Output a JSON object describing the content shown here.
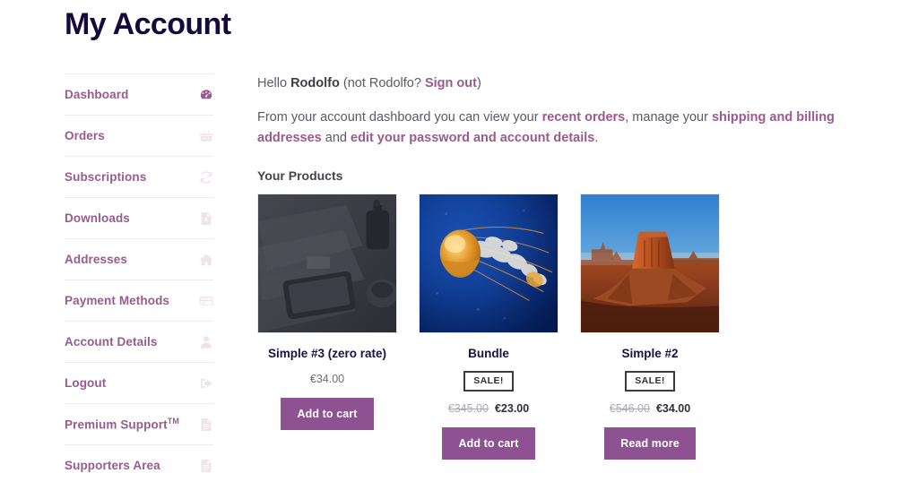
{
  "page_title": "My Account",
  "sidebar": {
    "items": [
      {
        "label": "Dashboard",
        "icon": "dashboard-gauge-icon",
        "active": true
      },
      {
        "label": "Orders",
        "icon": "basket-icon",
        "active": false
      },
      {
        "label": "Subscriptions",
        "icon": "refresh-cycle-icon",
        "active": false
      },
      {
        "label": "Downloads",
        "icon": "file-download-icon",
        "active": false
      },
      {
        "label": "Addresses",
        "icon": "home-icon",
        "active": false
      },
      {
        "label": "Payment Methods",
        "icon": "credit-card-icon",
        "active": false
      },
      {
        "label": "Account Details",
        "icon": "user-icon",
        "active": false
      },
      {
        "label": "Logout",
        "icon": "sign-out-icon",
        "active": false
      },
      {
        "label": "Premium Support",
        "suffix": "TM",
        "icon": "document-icon",
        "active": false
      },
      {
        "label": "Supporters Area",
        "icon": "document-icon",
        "active": false
      }
    ]
  },
  "main": {
    "greeting": {
      "hello": "Hello ",
      "user": "Rodolfo",
      "not_prefix": " (not Rodolfo? ",
      "sign_out": "Sign out",
      "close": ")"
    },
    "description": {
      "part1": "From your account dashboard you can view your ",
      "link1": "recent orders",
      "part2": ", manage your ",
      "link2": "shipping and billing addresses",
      "part3": " and ",
      "link3": "edit your password and account details",
      "part4": "."
    },
    "products_heading": "Your Products",
    "products": [
      {
        "name": "Simple #3 (zero rate)",
        "image": "grayscale-tablet-newspaper-photo",
        "on_sale": false,
        "sale_label": "",
        "old_price": "",
        "price": "€34.00",
        "button": "Add to cart"
      },
      {
        "name": "Bundle",
        "image": "jellyfish-underwater-photo",
        "on_sale": true,
        "sale_label": "SALE!",
        "old_price": "€345.00",
        "price": "€23.00",
        "button": "Add to cart"
      },
      {
        "name": "Simple #2",
        "image": "desert-butte-monument-valley-photo",
        "on_sale": true,
        "sale_label": "SALE!",
        "old_price": "€546.00",
        "price": "€34.00",
        "button": "Read more"
      }
    ]
  },
  "colors": {
    "title": "#140b3c",
    "accent_purple": "#9b5a8f",
    "button_purple": "#8e5191",
    "body_text": "#5a5a68",
    "divider": "#ececf0"
  }
}
